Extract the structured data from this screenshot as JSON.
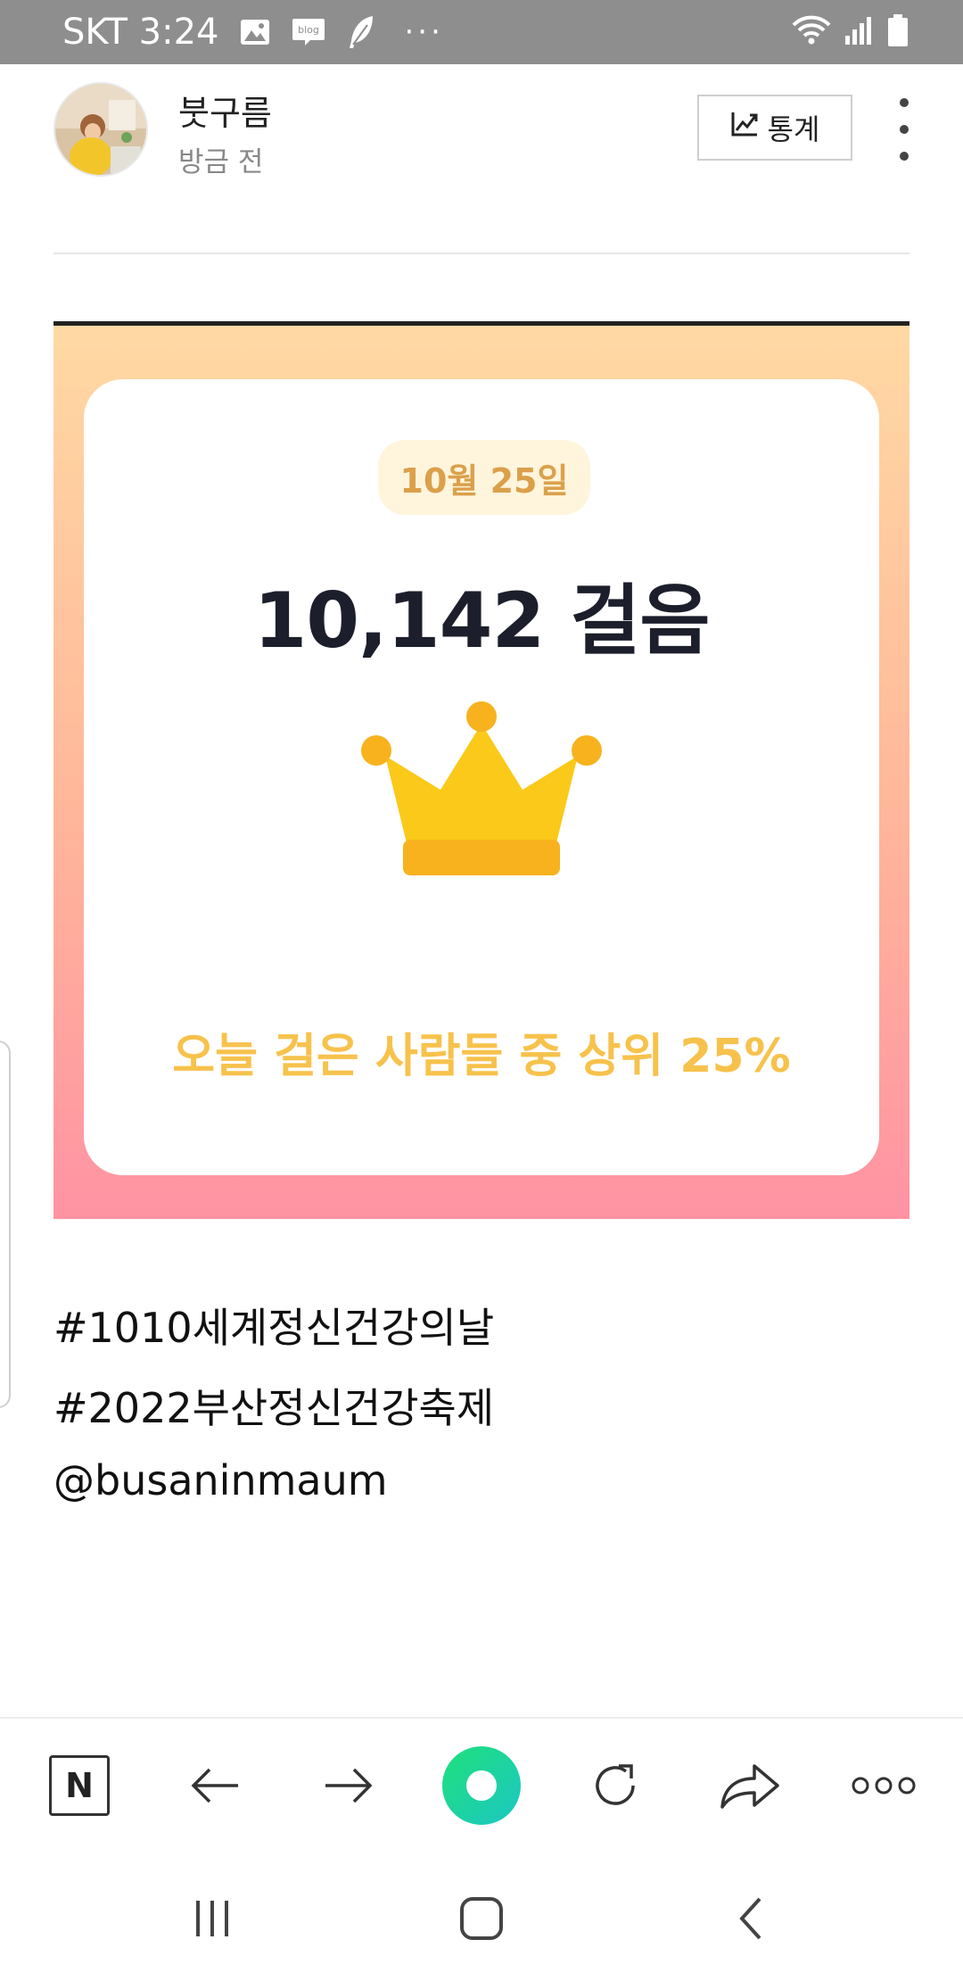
{
  "status_bar": {
    "carrier_time": "SKT 3:24",
    "icons": [
      "image-icon",
      "blog-icon",
      "feather-icon",
      "wifi-icon",
      "signal-icon",
      "battery-icon"
    ],
    "blog_icon_label": "blog",
    "more": "···"
  },
  "post": {
    "author": "붓구름",
    "time": "방금 전",
    "stats_label": "통계"
  },
  "image_card": {
    "date": "10월 25일",
    "steps": "10,142 걸음",
    "rank_text": "오늘 걸은 사람들 중 상위 25%"
  },
  "content": {
    "hashtags": [
      "#1010세계정신건강의날",
      "#2022부산정신건강축제"
    ],
    "mention": "@busaninmaum"
  },
  "toolbar": {
    "naver_label": "N",
    "items": [
      "naver-home-icon",
      "back-arrow-icon",
      "forward-arrow-icon",
      "green-dot-button",
      "refresh-icon",
      "share-icon",
      "more-icon"
    ]
  },
  "system_nav": {
    "items": [
      "recent-apps-icon",
      "home-icon",
      "back-icon"
    ]
  },
  "colors": {
    "status_bar": "#8e8e8e",
    "date_text": "#dba04a",
    "rank_text": "#f7c24c",
    "crown": "#fbc91a",
    "crown_band": "#f7b21e",
    "green_button": "#1fe07a"
  }
}
